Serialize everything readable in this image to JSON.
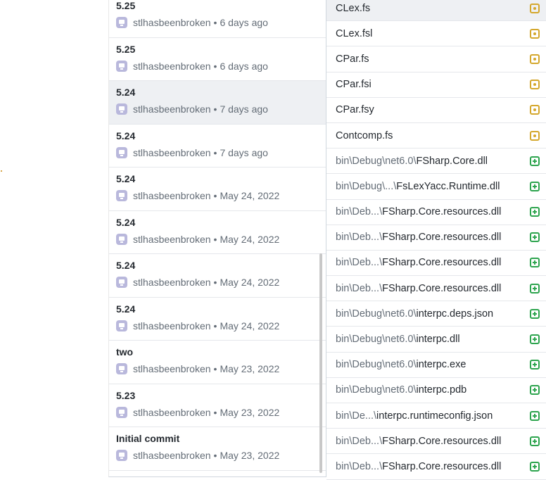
{
  "commits": [
    {
      "message": "5.25",
      "author": "stlhasbeenbroken",
      "sep": "•",
      "date": "6 days ago",
      "selected": false
    },
    {
      "message": "5.25",
      "author": "stlhasbeenbroken",
      "sep": "•",
      "date": "6 days ago",
      "selected": false
    },
    {
      "message": "5.24",
      "author": "stlhasbeenbroken",
      "sep": "•",
      "date": "7 days ago",
      "selected": true
    },
    {
      "message": "5.24",
      "author": "stlhasbeenbroken",
      "sep": "•",
      "date": "7 days ago",
      "selected": false
    },
    {
      "message": "5.24",
      "author": "stlhasbeenbroken",
      "sep": "•",
      "date": "May 24, 2022",
      "selected": false
    },
    {
      "message": "5.24",
      "author": "stlhasbeenbroken",
      "sep": "•",
      "date": "May 24, 2022",
      "selected": false
    },
    {
      "message": "5.24",
      "author": "stlhasbeenbroken",
      "sep": "•",
      "date": "May 24, 2022",
      "selected": false
    },
    {
      "message": "5.24",
      "author": "stlhasbeenbroken",
      "sep": "•",
      "date": "May 24, 2022",
      "selected": false
    },
    {
      "message": "two",
      "author": "stlhasbeenbroken",
      "sep": "•",
      "date": "May 23, 2022",
      "selected": false
    },
    {
      "message": "5.23",
      "author": "stlhasbeenbroken",
      "sep": "•",
      "date": "May 23, 2022",
      "selected": false
    },
    {
      "message": "Initial commit",
      "author": "stlhasbeenbroken",
      "sep": "•",
      "date": "May 23, 2022",
      "selected": false
    }
  ],
  "files": [
    {
      "dir": "",
      "name": "CLex.fs",
      "status": "modified",
      "status_icon": "file-modified-icon",
      "selected": true
    },
    {
      "dir": "",
      "name": "CLex.fsl",
      "status": "modified",
      "status_icon": "file-modified-icon",
      "selected": false
    },
    {
      "dir": "",
      "name": "CPar.fs",
      "status": "modified",
      "status_icon": "file-modified-icon",
      "selected": false
    },
    {
      "dir": "",
      "name": "CPar.fsi",
      "status": "modified",
      "status_icon": "file-modified-icon",
      "selected": false
    },
    {
      "dir": "",
      "name": "CPar.fsy",
      "status": "modified",
      "status_icon": "file-modified-icon",
      "selected": false
    },
    {
      "dir": "",
      "name": "Contcomp.fs",
      "status": "modified",
      "status_icon": "file-modified-icon",
      "selected": false
    },
    {
      "dir": "bin\\Debug\\net6.0\\",
      "name": "FSharp.Core.dll",
      "status": "added",
      "status_icon": "file-added-icon",
      "selected": false
    },
    {
      "dir": "bin\\Debug\\...\\",
      "name": "FsLexYacc.Runtime.dll",
      "status": "added",
      "status_icon": "file-added-icon",
      "selected": false
    },
    {
      "dir": "bin\\Deb...\\",
      "name": "FSharp.Core.resources.dll",
      "status": "added",
      "status_icon": "file-added-icon",
      "selected": false
    },
    {
      "dir": "bin\\Deb...\\",
      "name": "FSharp.Core.resources.dll",
      "status": "added",
      "status_icon": "file-added-icon",
      "selected": false
    },
    {
      "dir": "bin\\Deb...\\",
      "name": "FSharp.Core.resources.dll",
      "status": "added",
      "status_icon": "file-added-icon",
      "selected": false
    },
    {
      "dir": "bin\\Deb...\\",
      "name": "FSharp.Core.resources.dll",
      "status": "added",
      "status_icon": "file-added-icon",
      "selected": false
    },
    {
      "dir": "bin\\Debug\\net6.0\\",
      "name": "interpc.deps.json",
      "status": "added",
      "status_icon": "file-added-icon",
      "selected": false
    },
    {
      "dir": "bin\\Debug\\net6.0\\",
      "name": "interpc.dll",
      "status": "added",
      "status_icon": "file-added-icon",
      "selected": false
    },
    {
      "dir": "bin\\Debug\\net6.0\\",
      "name": "interpc.exe",
      "status": "added",
      "status_icon": "file-added-icon",
      "selected": false
    },
    {
      "dir": "bin\\Debug\\net6.0\\",
      "name": "interpc.pdb",
      "status": "added",
      "status_icon": "file-added-icon",
      "selected": false
    },
    {
      "dir": "bin\\De...\\",
      "name": "interpc.runtimeconfig.json",
      "status": "added",
      "status_icon": "file-added-icon",
      "selected": false
    },
    {
      "dir": "bin\\Deb...\\",
      "name": "FSharp.Core.resources.dll",
      "status": "added",
      "status_icon": "file-added-icon",
      "selected": false
    },
    {
      "dir": "bin\\Deb...\\",
      "name": "FSharp.Core.resources.dll",
      "status": "added",
      "status_icon": "file-added-icon",
      "selected": false
    }
  ],
  "colors": {
    "modified": "#d4a72c",
    "added": "#2da44e",
    "selected_bg": "#eef0f3",
    "avatar": "#b9b8dc"
  }
}
